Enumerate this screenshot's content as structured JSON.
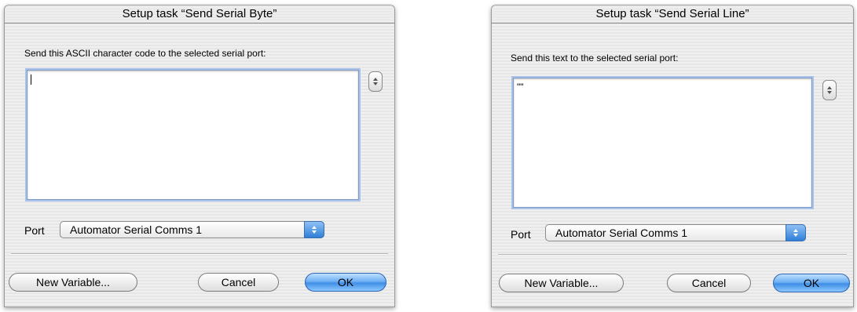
{
  "dialogs": [
    {
      "title": "Setup task “Send Serial Byte”",
      "prompt": "Send this ASCII character code to the selected serial port:",
      "text_value": "",
      "port_label": "Port",
      "port_value": "Automator Serial Comms 1",
      "buttons": {
        "new_variable": "New Variable...",
        "cancel": "Cancel",
        "ok": "OK"
      }
    },
    {
      "title": "Setup task “Send Serial Line”",
      "prompt": "Send this text to the selected serial port:",
      "text_value": "\"\"",
      "port_label": "Port",
      "port_value": "Automator Serial Comms 1",
      "buttons": {
        "new_variable": "New Variable...",
        "cancel": "Cancel",
        "ok": "OK"
      }
    }
  ],
  "colors": {
    "accent": "#3f8ee6",
    "focus_ring": "#a9c3e8"
  },
  "icons": [
    "stepper-icon",
    "popup-arrows-icon"
  ]
}
